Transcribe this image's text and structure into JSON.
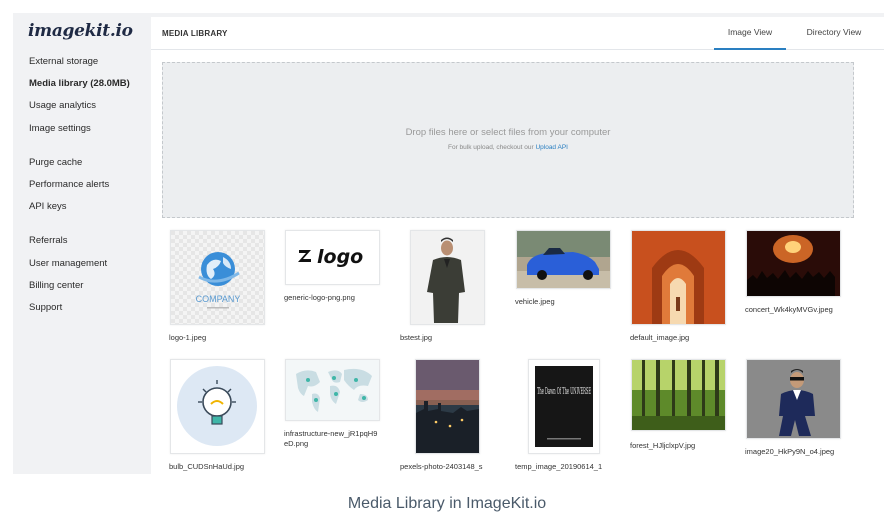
{
  "app": {
    "logo": "imagekit.io"
  },
  "sidebar": {
    "items": [
      {
        "label": "External storage"
      },
      {
        "label": "Media library (28.0MB)"
      },
      {
        "label": "Usage analytics"
      },
      {
        "label": "Image settings"
      },
      {
        "label": "Purge cache"
      },
      {
        "label": "Performance alerts"
      },
      {
        "label": "API keys"
      },
      {
        "label": "Referrals"
      },
      {
        "label": "User management"
      },
      {
        "label": "Billing center"
      },
      {
        "label": "Support"
      }
    ]
  },
  "header": {
    "title": "MEDIA LIBRARY",
    "tabs": [
      {
        "label": "Image View"
      },
      {
        "label": "Directory View"
      }
    ]
  },
  "dropzone": {
    "main_text": "Drop files here or select files from your computer",
    "sub_text": "For bulk upload, checkout our",
    "link_text": "Upload API"
  },
  "files": [
    {
      "name": "logo-1.jpeg"
    },
    {
      "name": "generic-logo-png.png"
    },
    {
      "name": "bstest.jpg"
    },
    {
      "name": "vehicle.jpeg"
    },
    {
      "name": "default_image.jpg"
    },
    {
      "name": "concert_Wk4kyMVGv.jpeg"
    },
    {
      "name": "bulb_CUDSnHaUd.jpg"
    },
    {
      "name": "infrastructure-new_jR1pqH9eD.png"
    },
    {
      "name": "pexels-photo-2403148_s"
    },
    {
      "name": "temp_image_20190614_1"
    },
    {
      "name": "forest_HJljclxpV.jpg"
    },
    {
      "name": "image20_HkPy9N_o4.jpeg"
    }
  ],
  "thumb_text": {
    "company": "COMPANY",
    "logo": "logo",
    "book_title": "The Dawn Of The UNIVERSE"
  },
  "caption": "Media Library in ImageKit.io",
  "colors": {
    "accent": "#2a7fc1",
    "sidebar_bg": "#f1f2f4"
  }
}
